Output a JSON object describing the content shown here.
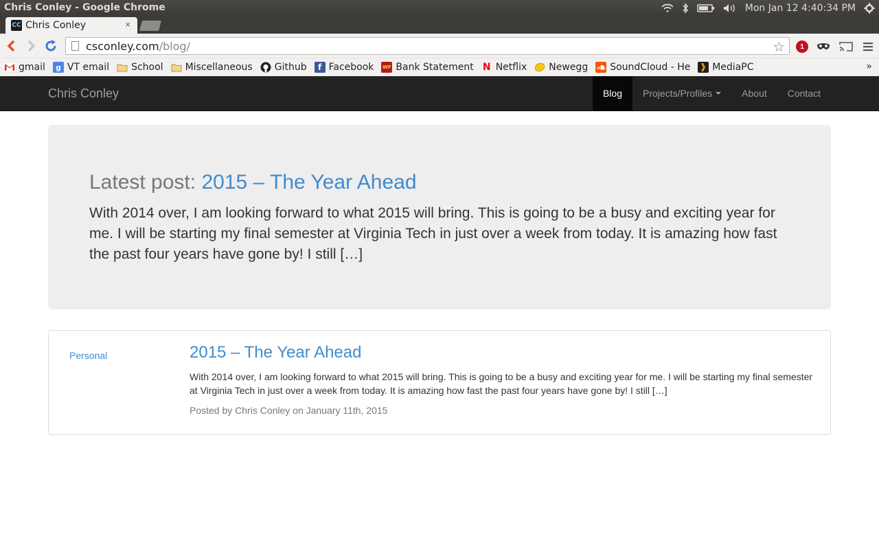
{
  "os": {
    "window_title": "Chris Conley - Google Chrome",
    "clock": "Mon Jan 12  4:40:34 PM",
    "indicators": [
      "wifi-icon",
      "bluetooth-icon",
      "battery-icon",
      "volume-icon",
      "settings-gear-icon"
    ]
  },
  "browser": {
    "tab_title": "Chris Conley",
    "tab_favicon": "CC",
    "tab_close": "×",
    "url_host": "csconley.com",
    "url_path": "/blog/",
    "ublock_badge": "1",
    "bookmarks": [
      {
        "label": "gmail",
        "icon": "gmail-icon"
      },
      {
        "label": "VT email",
        "icon": "google-icon"
      },
      {
        "label": "School",
        "icon": "folder-icon"
      },
      {
        "label": "Miscellaneous",
        "icon": "folder-icon"
      },
      {
        "label": "Github",
        "icon": "github-icon"
      },
      {
        "label": "Facebook",
        "icon": "facebook-icon"
      },
      {
        "label": "Bank Statement",
        "icon": "wells-fargo-icon"
      },
      {
        "label": "Netflix",
        "icon": "netflix-icon"
      },
      {
        "label": "Newegg",
        "icon": "newegg-icon"
      },
      {
        "label": "SoundCloud - Hea",
        "icon": "soundcloud-icon"
      },
      {
        "label": "MediaPC",
        "icon": "plex-icon"
      }
    ],
    "bookmarks_more": "»"
  },
  "site": {
    "brand": "Chris Conley",
    "nav": {
      "blog": "Blog",
      "projects": "Projects/Profiles",
      "about": "About",
      "contact": "Contact"
    },
    "jumbotron": {
      "prefix": "Latest post: ",
      "link": "2015 – The Year Ahead",
      "text": "With 2014 over, I am looking forward to what 2015 will bring. This is going to be a busy and exciting year for me. I will be starting my final semester at Virginia Tech in just over a week from today. It is amazing how fast the past four years have gone by! I still […]"
    },
    "posts": [
      {
        "category": "Personal",
        "title": "2015 – The Year Ahead",
        "excerpt": "With 2014 over, I am looking forward to what 2015 will bring. This is going to be a busy and exciting year for me. I will be starting my final semester at Virginia Tech in just over a week from today. It is amazing how fast the past four years have gone by! I still […]",
        "meta": "Posted by Chris Conley on January 11th, 2015"
      }
    ]
  }
}
